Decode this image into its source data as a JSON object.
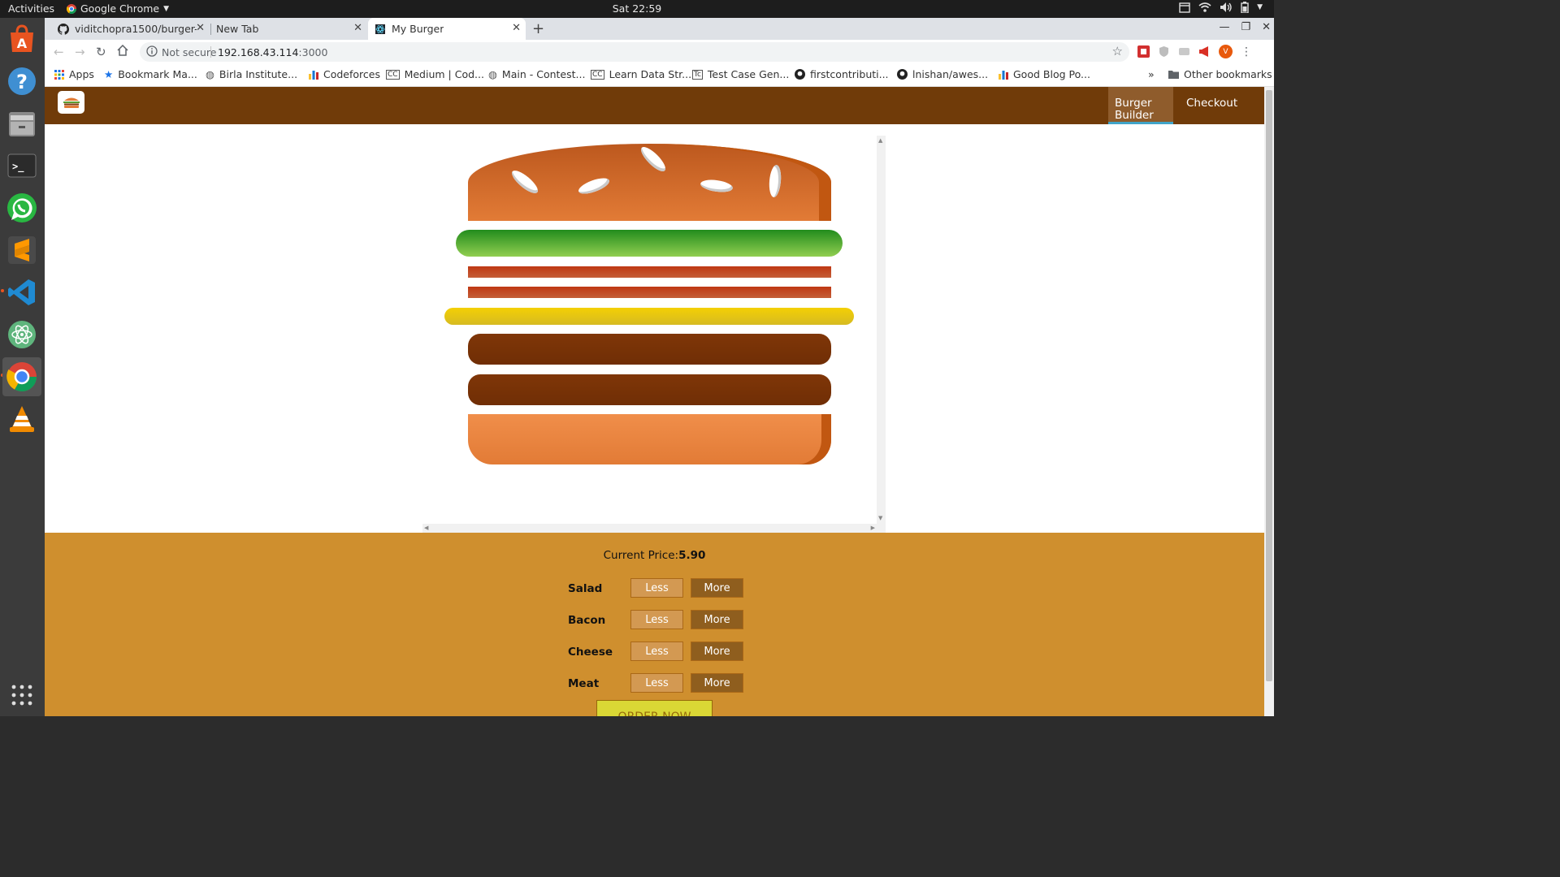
{
  "topbar": {
    "activities": "Activities",
    "app_name": "Google Chrome",
    "clock": "Sat 22:59"
  },
  "browser": {
    "tabs": [
      {
        "title": "viditchopra1500/burger-"
      },
      {
        "title": "New Tab"
      },
      {
        "title": "My Burger"
      }
    ],
    "address": {
      "security": "Not secure",
      "host": "192.168.43.114",
      "port": ":3000"
    },
    "profile_initial": "V",
    "bookmarks": [
      "Apps",
      "Bookmark Ma...",
      "Birla Institute...",
      "Codeforces",
      "Medium | Cod...",
      "Main - Contest...",
      "Learn Data Str...",
      "Test Case Gen...",
      "firstcontributi...",
      "lnishan/awes...",
      "Good Blog Po..."
    ],
    "bookmarks_overflow": "»",
    "other_bookmarks": "Other bookmarks"
  },
  "app": {
    "nav": {
      "burger_builder": "Burger Builder",
      "checkout": "Checkout"
    },
    "burger": {
      "ingredients": [
        "bread-top",
        "salad",
        "bacon",
        "bacon",
        "cheese",
        "meat",
        "meat",
        "bread-bottom"
      ]
    },
    "controls": {
      "price_label": "Current Price:",
      "price_value": "5.90",
      "less_label": "Less",
      "more_label": "More",
      "ingredients": [
        "Salad",
        "Bacon",
        "Cheese",
        "Meat"
      ],
      "order_label": "ORDER NOW"
    }
  },
  "icons": {
    "dock": [
      "ubuntu-software-icon",
      "help-icon",
      "files-icon",
      "terminal-icon",
      "whatsapp-icon",
      "sublime-text-icon",
      "vscode-icon",
      "atom-icon",
      "chrome-icon",
      "vlc-icon",
      "show-apps-icon"
    ]
  },
  "colors": {
    "app_toolbar": "#703b09",
    "controls_bg": "#cf8f2e",
    "nav_active_underline": "#40a4c8"
  }
}
